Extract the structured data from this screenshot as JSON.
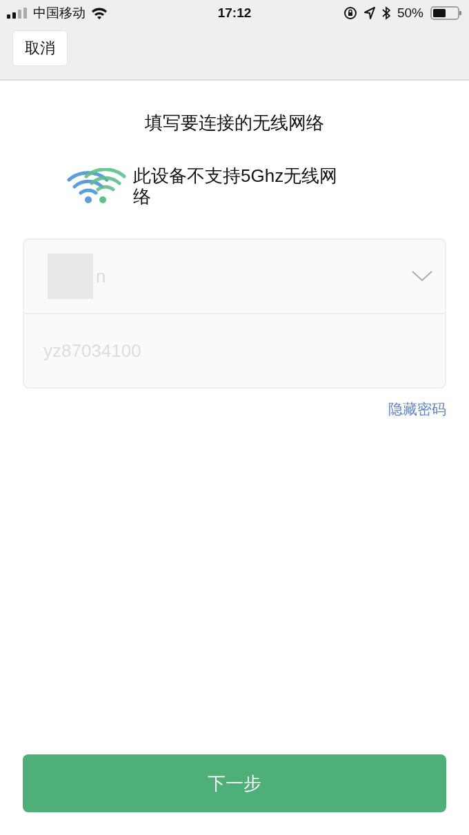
{
  "status_bar": {
    "carrier": "中国移动",
    "time": "17:12",
    "battery": "50%"
  },
  "nav_bar": {
    "cancel_button": "取消"
  },
  "title": "填写要连接的无线网络",
  "notice": "此设备不支持5Ghz无线网络",
  "form": {
    "network_field": {
      "value": "n"
    },
    "password_field": {
      "value": "yz87034100"
    },
    "toggle_password_link": "隐藏密码"
  },
  "next_button": "下一步"
}
